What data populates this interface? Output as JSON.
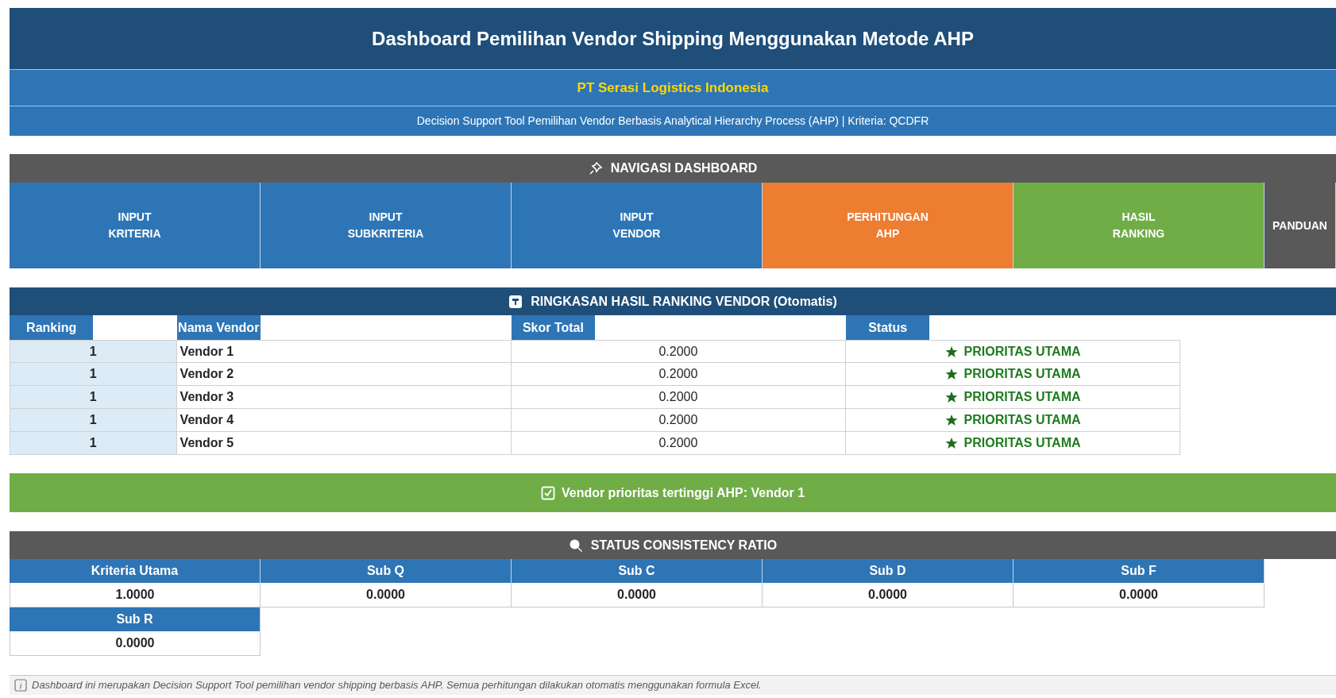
{
  "header": {
    "title": "Dashboard Pemilihan Vendor Shipping Menggunakan Metode AHP",
    "company": "PT Serasi Logistics Indonesia",
    "subtitle": "Decision Support Tool Pemilihan Vendor Berbasis Analytical Hierarchy Process (AHP) | Kriteria: QCDFR"
  },
  "navigation": {
    "title": "NAVIGASI DASHBOARD",
    "items": [
      {
        "lines": [
          "INPUT",
          "KRITERIA"
        ],
        "color": "#2e75b6"
      },
      {
        "lines": [
          "INPUT",
          "SUBKRITERIA"
        ],
        "color": "#2e75b6"
      },
      {
        "lines": [
          "INPUT",
          "VENDOR"
        ],
        "color": "#2e75b6"
      },
      {
        "lines": [
          "PERHITUNGAN",
          "AHP"
        ],
        "color": "#ed7d31"
      },
      {
        "lines": [
          "HASIL",
          "RANKING"
        ],
        "color": "#70ad47"
      },
      {
        "lines": [
          "PANDUAN"
        ],
        "color": "#595959"
      }
    ]
  },
  "ranking": {
    "title": "RINGKASAN HASIL RANKING VENDOR (Otomatis)",
    "columns": [
      "Ranking",
      "Nama Vendor",
      "Skor Total",
      "Status"
    ],
    "rows": [
      {
        "rank": "1",
        "vendor": "Vendor 1",
        "score": "0.2000",
        "status": "PRIORITAS UTAMA"
      },
      {
        "rank": "1",
        "vendor": "Vendor 2",
        "score": "0.2000",
        "status": "PRIORITAS UTAMA"
      },
      {
        "rank": "1",
        "vendor": "Vendor 3",
        "score": "0.2000",
        "status": "PRIORITAS UTAMA"
      },
      {
        "rank": "1",
        "vendor": "Vendor 4",
        "score": "0.2000",
        "status": "PRIORITAS UTAMA"
      },
      {
        "rank": "1",
        "vendor": "Vendor 5",
        "score": "0.2000",
        "status": "PRIORITAS UTAMA"
      }
    ]
  },
  "banner": "Vendor prioritas tertinggi AHP: Vendor 1",
  "consistency": {
    "title": "STATUS CONSISTENCY RATIO",
    "items": [
      {
        "label": "Kriteria Utama",
        "value": "1.0000"
      },
      {
        "label": "Sub Q",
        "value": "0.0000"
      },
      {
        "label": "Sub C",
        "value": "0.0000"
      },
      {
        "label": "Sub D",
        "value": "0.0000"
      },
      {
        "label": "Sub F",
        "value": "0.0000"
      },
      {
        "label": "Sub R",
        "value": "0.0000"
      }
    ]
  },
  "footer": "Dashboard ini merupakan Decision Support Tool pemilihan vendor shipping berbasis AHP. Semua perhitungan dilakukan otomatis menggunakan formula Excel."
}
